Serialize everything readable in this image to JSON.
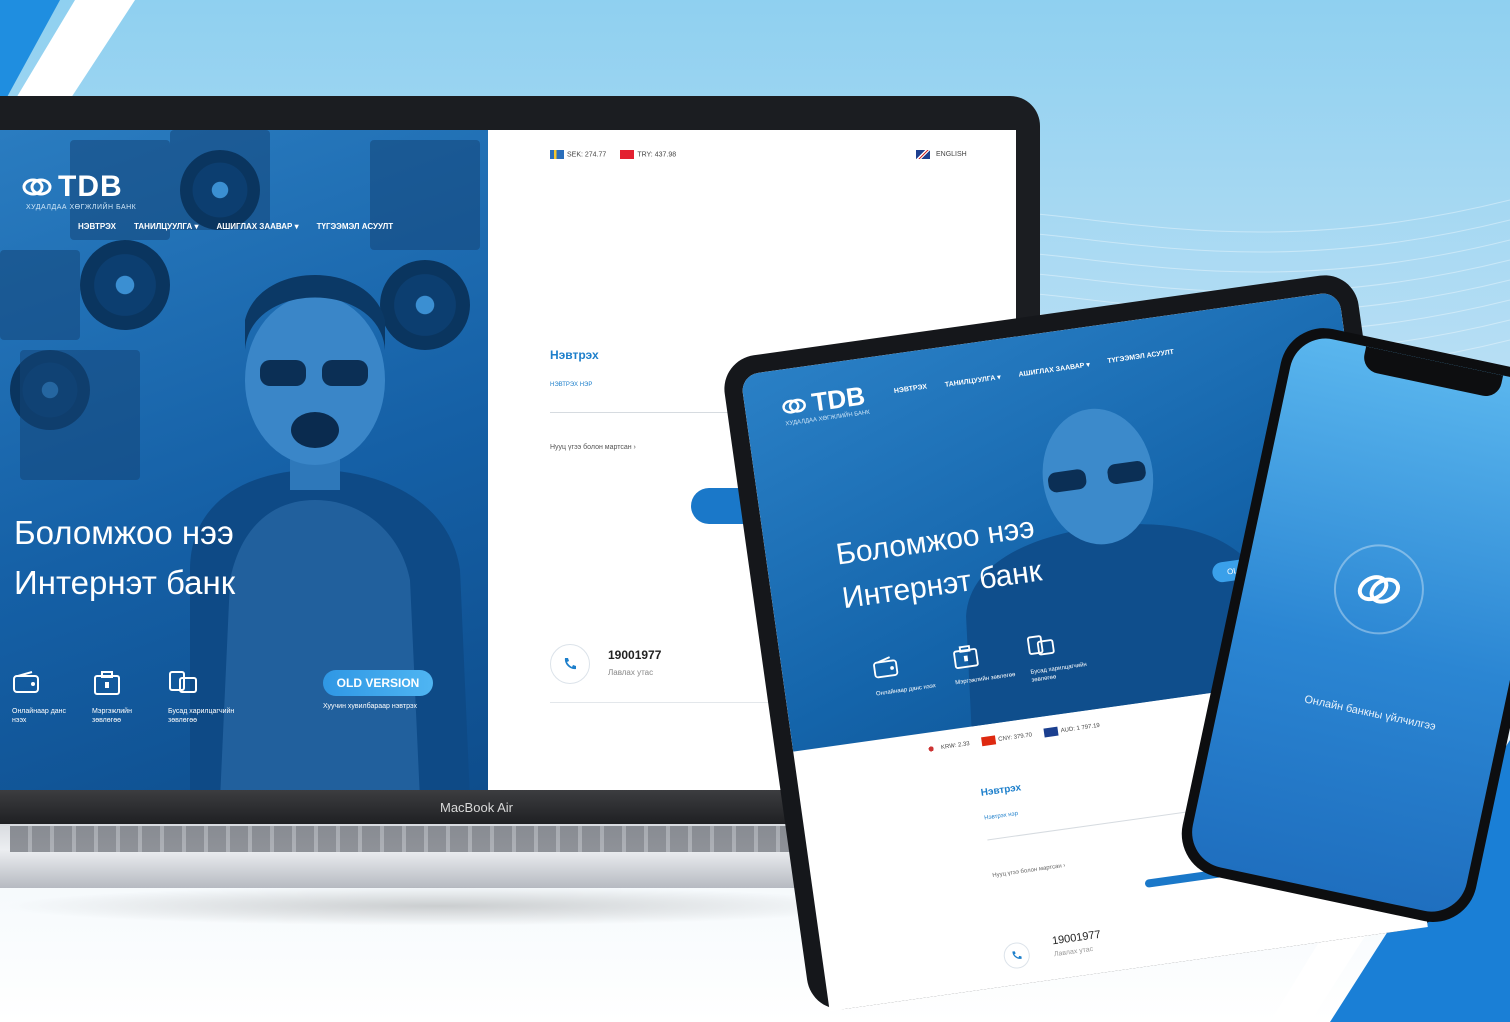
{
  "laptop": {
    "brand": "TDB",
    "brand_sub": "ХУДАЛДАА ХӨГЖЛИЙН БАНК",
    "nav": [
      "НЭВТРЭХ",
      "ТАНИЛЦУУЛГА ▾",
      "АШИГЛАХ ЗААВАР ▾",
      "ТҮГЭЭМЭЛ АСУУЛТ"
    ],
    "hero_title_line1": "Боломжоо нээ",
    "hero_title_line2": "Интернэт банк",
    "features": [
      {
        "icon": "wallet-icon",
        "label": "Онлайнаар данс нээх"
      },
      {
        "icon": "briefcase-icon",
        "label": "Мэргэжлийн зөвлөгөө"
      },
      {
        "icon": "cards-icon",
        "label": "Бусад харилцагчийн зөвлөгөө"
      }
    ],
    "old_version_label": "OLD VERSION",
    "old_version_note": "Хуучин хувилбараар нэвтрэх",
    "rates": [
      {
        "currency": "SEK: 274.77",
        "flag": "sweden-flag-icon"
      },
      {
        "currency": "TRY: 437.98",
        "flag": "turkey-flag-icon"
      }
    ],
    "language": "ENGLISH",
    "login_title": "Нэвтрэх",
    "login_label": "НЭВТРЭХ НЭР",
    "forgot_password": "Нууц үгээ болон мартсан ›",
    "phone_number": "19001977",
    "phone_label": "Лавлах утас",
    "device_label": "MacBook Air"
  },
  "tablet": {
    "brand": "TDB",
    "brand_sub": "ХУДАЛДАА ХӨГЖЛИЙН БАНК",
    "nav": [
      "НЭВТРЭХ",
      "ТАНИЛЦУУЛГА ▾",
      "АШИГЛАХ ЗААВАР ▾",
      "ТҮГЭЭМЭЛ АСУУЛТ"
    ],
    "hero_title_line1": "Боломжоо нээ",
    "hero_title_line2": "Интернэт банк",
    "features": [
      {
        "label": "Онлайнаар данс нээх"
      },
      {
        "label": "Мэргэжлийн зөвлөгөө"
      },
      {
        "label": "Бусад харилцагчийн зөвлөгөө"
      }
    ],
    "old_version_label": "OLD VERSION",
    "rates": [
      "KRW: 2.33",
      "CNY: 379.70",
      "AUD: 1 797.19"
    ],
    "login_title": "Нэвтрэх",
    "login_label": "Нэвтрэх нэр",
    "forgot_password": "Нууц үгээ болон мартсан ›",
    "phone_number": "19001977",
    "phone_label": "Лавлах утас"
  },
  "phone": {
    "splash_text": "Онлайн банкны үйлчилгээ"
  },
  "colors": {
    "brand_blue": "#1a78c9",
    "hero_blue": "#1560a6",
    "accent_light": "#4fb5f2"
  }
}
